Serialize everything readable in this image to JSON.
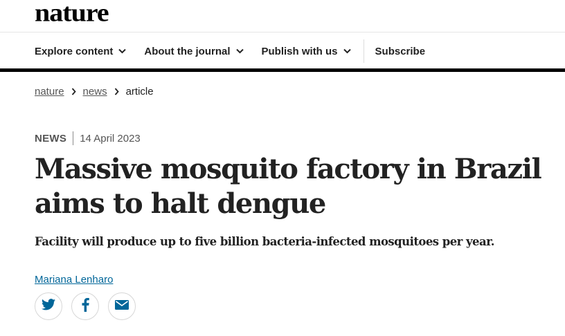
{
  "header": {
    "logo_text": "nature"
  },
  "nav": {
    "items": [
      {
        "label": "Explore content",
        "icon": "chevron-down-icon"
      },
      {
        "label": "About the journal",
        "icon": "chevron-down-icon"
      },
      {
        "label": "Publish with us",
        "icon": "chevron-down-icon"
      }
    ],
    "subscribe_label": "Subscribe"
  },
  "breadcrumb": {
    "items": [
      "nature",
      "news"
    ],
    "current": "article",
    "separator_icon": "chevron-right-icon"
  },
  "article": {
    "type": "NEWS",
    "date": "14 April 2023",
    "title": "Massive mosquito factory in Brazil aims to halt dengue",
    "standfirst": "Facility will produce up to five billion bacteria-infected mosquitoes per year.",
    "author": "Mariana Lenharo"
  },
  "share": {
    "buttons": [
      {
        "icon": "twitter-icon"
      },
      {
        "icon": "facebook-icon"
      },
      {
        "icon": "email-icon"
      }
    ]
  },
  "colors": {
    "accent_blue": "#006699",
    "text": "#222222",
    "muted": "#555555"
  }
}
